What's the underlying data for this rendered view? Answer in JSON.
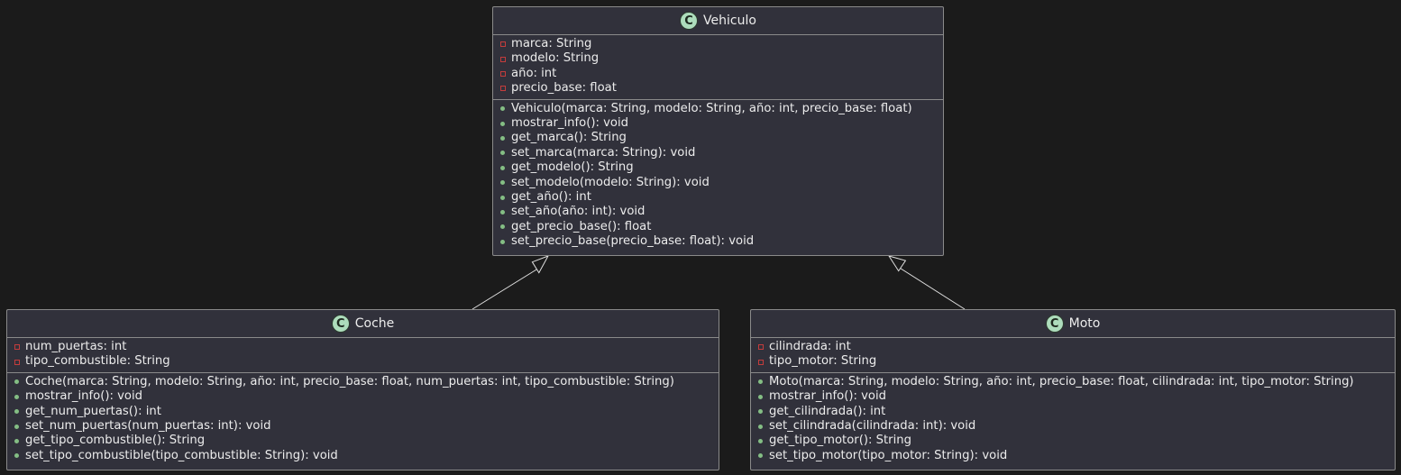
{
  "colors": {
    "background": "#1b1b1b",
    "box_fill": "#31313b",
    "box_border": "#8a8a8a",
    "text": "#ececec",
    "private_marker": "#c43c3c",
    "public_marker": "#84be84",
    "class_icon": "#adddbc"
  },
  "classes": {
    "vehiculo": {
      "icon": "C",
      "name": "Vehiculo",
      "attributes": [
        "marca: String",
        "modelo: String",
        "año: int",
        "precio_base: float"
      ],
      "methods": [
        "Vehiculo(marca: String, modelo: String, año: int, precio_base: float)",
        "mostrar_info(): void",
        "get_marca(): String",
        "set_marca(marca: String): void",
        "get_modelo(): String",
        "set_modelo(modelo: String): void",
        "get_año(): int",
        "set_año(año: int): void",
        "get_precio_base(): float",
        "set_precio_base(precio_base: float): void"
      ]
    },
    "coche": {
      "icon": "C",
      "name": "Coche",
      "attributes": [
        "num_puertas: int",
        "tipo_combustible: String"
      ],
      "methods": [
        "Coche(marca: String, modelo: String, año: int, precio_base: float, num_puertas: int, tipo_combustible: String)",
        "mostrar_info(): void",
        "get_num_puertas(): int",
        "set_num_puertas(num_puertas: int): void",
        "get_tipo_combustible(): String",
        "set_tipo_combustible(tipo_combustible: String): void"
      ]
    },
    "moto": {
      "icon": "C",
      "name": "Moto",
      "attributes": [
        "cilindrada: int",
        "tipo_motor: String"
      ],
      "methods": [
        "Moto(marca: String, modelo: String, año: int, precio_base: float, cilindrada: int, tipo_motor: String)",
        "mostrar_info(): void",
        "get_cilindrada(): int",
        "set_cilindrada(cilindrada: int): void",
        "get_tipo_motor(): String",
        "set_tipo_motor(tipo_motor: String): void"
      ]
    }
  },
  "relations": [
    {
      "from": "coche",
      "to": "vehiculo",
      "type": "inheritance"
    },
    {
      "from": "moto",
      "to": "vehiculo",
      "type": "inheritance"
    }
  ]
}
